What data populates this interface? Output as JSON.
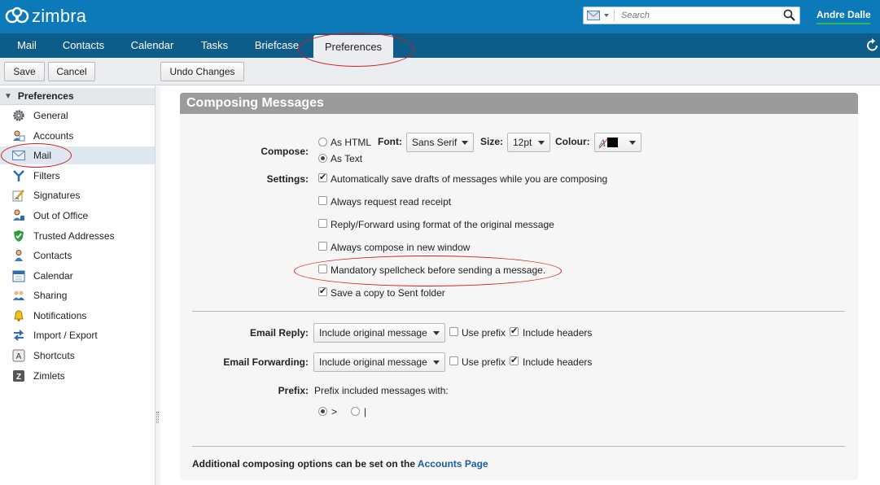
{
  "header": {
    "logo_text": "zimbra",
    "search_placeholder": "Search",
    "user_name": "Andre Dalle"
  },
  "tabs": [
    {
      "label": "Mail"
    },
    {
      "label": "Contacts"
    },
    {
      "label": "Calendar"
    },
    {
      "label": "Tasks"
    },
    {
      "label": "Briefcase"
    },
    {
      "label": "Preferences",
      "active": true
    }
  ],
  "toolbar": {
    "save_label": "Save",
    "cancel_label": "Cancel",
    "undo_label": "Undo Changes"
  },
  "sidebar": {
    "title": "Preferences",
    "items": [
      {
        "label": "General",
        "icon": "gear-icon"
      },
      {
        "label": "Accounts",
        "icon": "accounts-icon"
      },
      {
        "label": "Mail",
        "icon": "mail-icon",
        "selected": true
      },
      {
        "label": "Filters",
        "icon": "filter-icon"
      },
      {
        "label": "Signatures",
        "icon": "signature-icon"
      },
      {
        "label": "Out of Office",
        "icon": "out-of-office-icon"
      },
      {
        "label": "Trusted Addresses",
        "icon": "shield-icon"
      },
      {
        "label": "Contacts",
        "icon": "contact-icon"
      },
      {
        "label": "Calendar",
        "icon": "calendar-icon"
      },
      {
        "label": "Sharing",
        "icon": "sharing-icon"
      },
      {
        "label": "Notifications",
        "icon": "bell-icon"
      },
      {
        "label": "Import / Export",
        "icon": "import-export-icon"
      },
      {
        "label": "Shortcuts",
        "icon": "keyboard-icon"
      },
      {
        "label": "Zimlets",
        "icon": "zimlet-icon"
      }
    ]
  },
  "panel": {
    "title": "Composing Messages",
    "compose": {
      "label": "Compose:",
      "as_html": "As HTML",
      "as_text": "As Text",
      "selected": "As Text",
      "font_label": "Font:",
      "font_value": "Sans Serif",
      "size_label": "Size:",
      "size_value": "12pt",
      "colour_label": "Colour:",
      "colour_value": "#000000"
    },
    "settings": {
      "label": "Settings:",
      "options": [
        {
          "label": "Automatically save drafts of messages while you are composing",
          "checked": true
        },
        {
          "label": "Always request read receipt",
          "checked": false
        },
        {
          "label": "Reply/Forward using format of the original message",
          "checked": false
        },
        {
          "label": "Always compose in new window",
          "checked": false
        },
        {
          "label": "Mandatory spellcheck before sending a message.",
          "checked": false
        },
        {
          "label": "Save a copy to Sent folder",
          "checked": true
        }
      ]
    },
    "email_reply": {
      "label": "Email Reply:",
      "value": "Include original message",
      "use_prefix": "Use prefix",
      "use_prefix_checked": false,
      "include_headers": "Include headers",
      "include_headers_checked": true
    },
    "email_forwarding": {
      "label": "Email Forwarding:",
      "value": "Include original message",
      "use_prefix": "Use prefix",
      "use_prefix_checked": false,
      "include_headers": "Include headers",
      "include_headers_checked": true
    },
    "prefix": {
      "label": "Prefix:",
      "description": "Prefix included messages with:",
      "options": [
        ">",
        "|"
      ],
      "selected": ">"
    },
    "footer": {
      "text": "Additional composing options can be set on the ",
      "link": "Accounts Page"
    }
  },
  "colors": {
    "header_bg": "#0c79b9",
    "tabbar_bg": "#0e5c8a",
    "annotation_red": "#d31f1f"
  }
}
